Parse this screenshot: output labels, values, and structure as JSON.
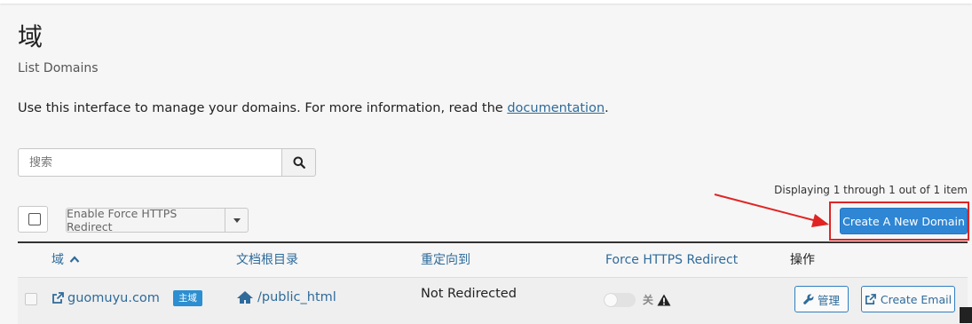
{
  "page": {
    "title": "域",
    "subtitle": "List Domains",
    "intro_text": "Use this interface to manage your domains. For more information, read the ",
    "intro_link": "documentation",
    "intro_end": "."
  },
  "search": {
    "placeholder": "搜索",
    "value": "",
    "button_icon": "search-icon"
  },
  "toolbar": {
    "display_count": "Displaying 1 through 1 out of 1 item",
    "bulk_action_label": "Enable Force HTTPS Redirect",
    "create_button_label": "Create A New Domain"
  },
  "table": {
    "headers": {
      "domain": "域",
      "docroot": "文档根目录",
      "redirect": "重定向到",
      "force_https": "Force HTTPS Redirect",
      "actions": "操作"
    },
    "sort": {
      "column": "domain",
      "direction": "ascending"
    },
    "rows": [
      {
        "domain": "guomuyu.com",
        "badge": "主域",
        "docroot": "/public_html",
        "redirect": "Not Redirected",
        "force_https_state": "关",
        "manage_label": "管理",
        "email_label": "Create Email"
      }
    ]
  },
  "colors": {
    "accent": "#2e86d4",
    "link": "#2f6b9a",
    "highlight": "#e02424",
    "badge": "#2b8fd1",
    "background": "#f6f6f6"
  }
}
